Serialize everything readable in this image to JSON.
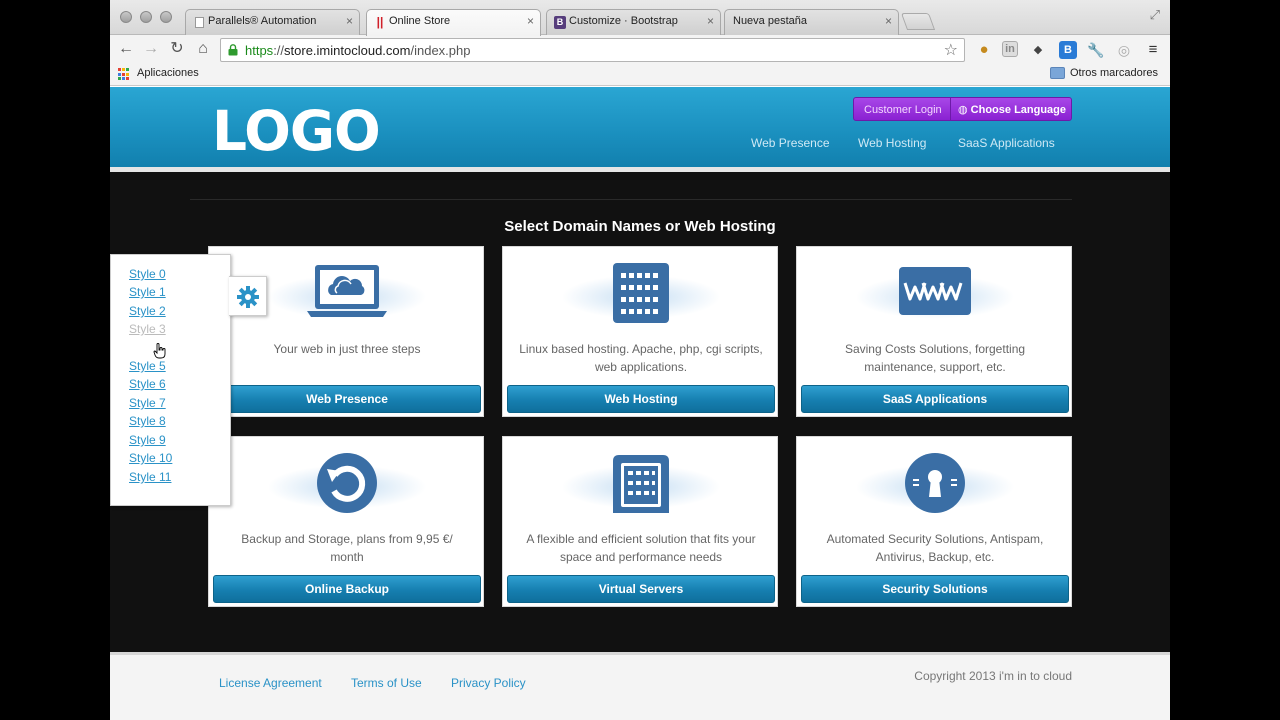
{
  "browser": {
    "tabs": [
      {
        "label": "Parallels® Automation",
        "favicon": "page-icon"
      },
      {
        "label": "Online Store",
        "favicon": "parallels-icon"
      },
      {
        "label": "Customize · Bootstrap",
        "favicon": "bootstrap-icon"
      },
      {
        "label": "Nueva pestaña",
        "favicon": "none"
      }
    ],
    "url": {
      "scheme": "https",
      "sep": "://",
      "domain": "store.imintocloud.com",
      "path": "/index.php"
    },
    "bookmarks": {
      "apps_label": "Aplicaciones",
      "other_label": "Otros marcadores"
    }
  },
  "site": {
    "logo": "LOGO",
    "login_label": "Customer Login",
    "language_label": "Choose Language",
    "nav": [
      "Web Presence",
      "Web Hosting",
      "SaaS Applications"
    ],
    "section_title": "Select Domain Names or Web Hosting",
    "cards": [
      {
        "desc": "Your web in just three steps",
        "button": "Web Presence",
        "icon": "laptop-cloud-icon"
      },
      {
        "desc": "Linux based hosting. Apache, php, cgi scripts, web applications.",
        "button": "Web Hosting",
        "icon": "server-icon"
      },
      {
        "desc": "Saving Costs Solutions, forgetting maintenance, support, etc.",
        "button": "SaaS Applications",
        "icon": "www-icon"
      },
      {
        "desc": "Backup and Storage, plans from 9,95 €/ month",
        "button": "Online Backup",
        "icon": "backup-icon"
      },
      {
        "desc": "A flexible and efficient solution that fits your space and performance needs",
        "button": "Virtual Servers",
        "icon": "virtual-server-icon"
      },
      {
        "desc": "Automated Security Solutions, Antispam, Antivirus, Backup, etc.",
        "button": "Security Solutions",
        "icon": "keyhole-icon"
      }
    ],
    "footer": {
      "links": [
        "License Agreement",
        "Terms of Use",
        "Privacy Policy"
      ],
      "copyright": "Copyright 2013 i'm in to cloud"
    },
    "style_switcher": [
      "Style 0",
      "Style 1",
      "Style 2",
      "Style 3",
      "Style 5",
      "Style 6",
      "Style 7",
      "Style 8",
      "Style 9",
      "Style 10",
      "Style 11"
    ],
    "style_switcher_active": "Style 3"
  },
  "colors": {
    "accent": "#1a8fbe",
    "purple": "#8a21d2",
    "icon_blue": "#3a6ea5"
  }
}
